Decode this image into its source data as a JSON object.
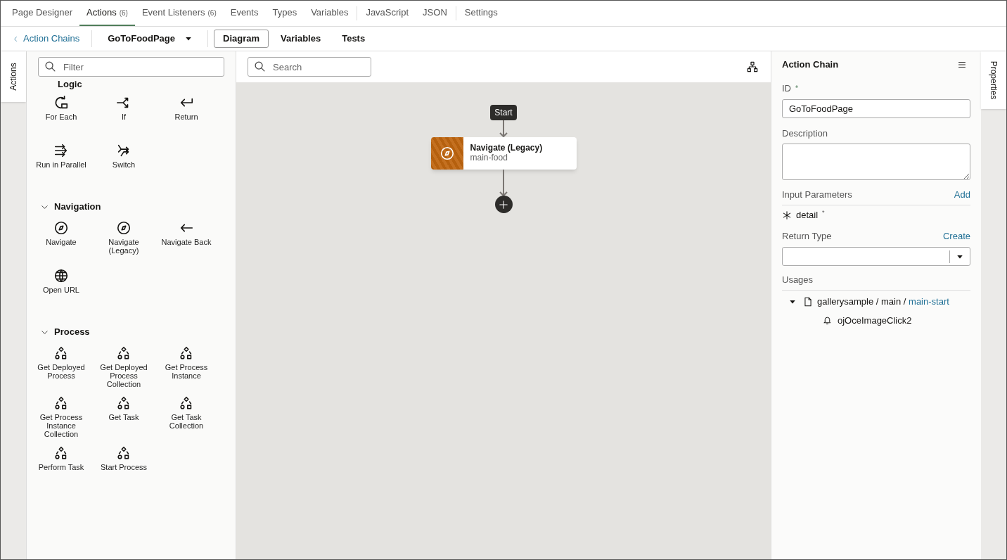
{
  "top_tab_groups": [
    [
      {
        "label": "Page Designer",
        "selected": false
      },
      {
        "label": "Actions",
        "count": "(6)",
        "selected": true
      },
      {
        "label": "Event Listeners",
        "count": "(6)",
        "selected": false
      },
      {
        "label": "Events",
        "selected": false
      },
      {
        "label": "Types",
        "selected": false
      },
      {
        "label": "Variables",
        "selected": false
      }
    ],
    [
      {
        "label": "JavaScript",
        "selected": false
      },
      {
        "label": "JSON",
        "selected": false
      }
    ],
    [
      {
        "label": "Settings",
        "selected": false
      }
    ]
  ],
  "toolbar": {
    "back_link": "Action Chains",
    "chain_name": "GoToFoodPage",
    "view_tabs": [
      {
        "label": "Diagram",
        "selected": true
      },
      {
        "label": "Variables",
        "selected": false
      },
      {
        "label": "Tests",
        "selected": false
      }
    ]
  },
  "left_side_tab": "Actions",
  "palette": {
    "filter_placeholder": "Filter",
    "sections": [
      {
        "title": "Logic",
        "items": [
          "For Each",
          "If",
          "Return",
          "Run in Parallel",
          "Switch"
        ]
      },
      {
        "title": "Navigation",
        "expanded": true,
        "items": [
          "Navigate",
          "Navigate (Legacy)",
          "Navigate Back",
          "Open URL"
        ]
      },
      {
        "title": "Process",
        "expanded": true,
        "items": [
          "Get Deployed Process",
          "Get Deployed Process Collection",
          "Get Process Instance",
          "Get Process Instance Collection",
          "Get Task",
          "Get Task Collection",
          "Perform Task",
          "Start Process"
        ]
      }
    ]
  },
  "diagram": {
    "search_placeholder": "Search",
    "start_label": "Start",
    "nodes": [
      {
        "title": "Navigate (Legacy)",
        "subtitle": "main-food"
      }
    ]
  },
  "properties": {
    "title": "Action Chain",
    "id_label": "ID",
    "id_required_mark": "*",
    "id_value": "GoToFoodPage",
    "description_label": "Description",
    "input_parameters_label": "Input Parameters",
    "add_link": "Add",
    "parameters": [
      {
        "name": "detail",
        "required_mark": "*"
      }
    ],
    "return_type_label": "Return Type",
    "create_link": "Create",
    "usages_label": "Usages",
    "usages": [
      {
        "path": "gallerysample / main / ",
        "link": "main-start",
        "expanded": true,
        "children": [
          {
            "label": "ojOceImageClick2"
          }
        ]
      }
    ]
  },
  "right_side_tab": "Properties"
}
